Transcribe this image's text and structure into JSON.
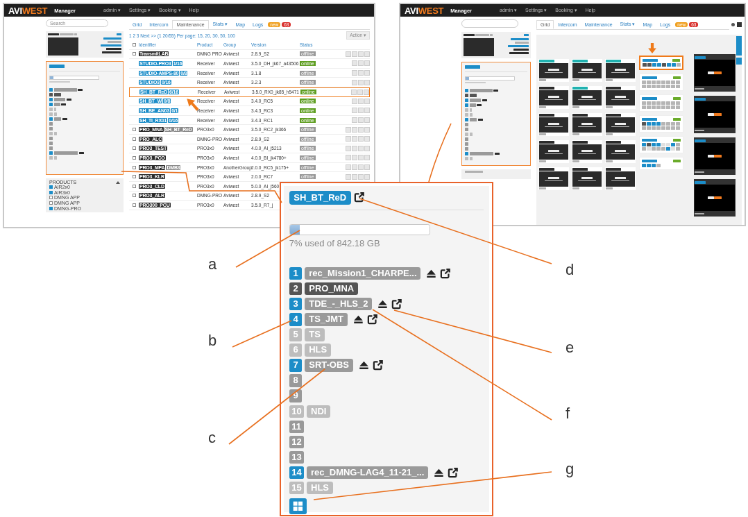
{
  "left_screenshot": {
    "header": {
      "logo": [
        "AVI",
        "WEST"
      ],
      "app_name": "Manager",
      "menu": [
        "admin ▾",
        "Settings ▾",
        "Booking ▾",
        "Help"
      ]
    },
    "search": {
      "placeholder": "Search"
    },
    "products": {
      "title": "PRODUCTS",
      "items": [
        {
          "label": "AIR2x0",
          "checked": true
        },
        {
          "label": "AIR3x0",
          "checked": true
        },
        {
          "label": "DMNG APP",
          "checked": false
        },
        {
          "label": "DMNG APP",
          "checked": false
        },
        {
          "label": "DMNG-PRO",
          "checked": true
        }
      ]
    },
    "tabs": [
      {
        "label": "Grid",
        "selected": false
      },
      {
        "label": "Intercom",
        "selected": false
      },
      {
        "label": "Maintenance",
        "selected": true
      },
      {
        "label": "Stats ▾",
        "selected": false
      },
      {
        "label": "Map",
        "selected": false
      },
      {
        "label": "Logs",
        "selected": false
      }
    ],
    "log_badges": [
      {
        "text": "new",
        "color": "#f0a020"
      },
      {
        "text": "63",
        "color": "#d9302c"
      }
    ],
    "pagination": "1 2 3 Next >> (1 20/55) Per page: 15, 20, 30, 50, 100",
    "action_button": "Action ▾",
    "columns": [
      "Identifier",
      "Product",
      "Group",
      "Version",
      "Status"
    ],
    "select_all": {
      "checked": false
    },
    "rows": [
      {
        "kind": "unit",
        "id": "TransmitLAB",
        "product": "DMNG PRO",
        "group": "Aviwest",
        "version": "2.8.9_S2",
        "status": "offline",
        "online": false,
        "highlighted": false
      },
      {
        "kind": "receiver",
        "id": "STUDIO-PRO3",
        "extra": "1/16",
        "product": "Receiver",
        "group": "Aviwest",
        "version": "3.5.0_DH_jk67_a43506",
        "status": "online",
        "online": true,
        "highlighted": false
      },
      {
        "kind": "receiver",
        "id": "STUDIO-AMPS-80",
        "extra": "0/8",
        "product": "Receiver",
        "group": "Aviwest",
        "version": "3.1.8",
        "status": "offline",
        "online": false,
        "highlighted": false
      },
      {
        "kind": "receiver",
        "id": "STUDIO3",
        "extra": "0/16",
        "product": "Receiver",
        "group": "Aviwest",
        "version": "3.2.3",
        "status": "offline",
        "online": false,
        "highlighted": false
      },
      {
        "kind": "receiver",
        "id": "SH_BT_ReD",
        "extra": "6/16",
        "product": "Receiver",
        "group": "Aviwest",
        "version": "3.5.0_RX0_jk85_h5471",
        "status": "online",
        "online": true,
        "highlighted": true
      },
      {
        "kind": "receiver",
        "id": "SH_BT_W",
        "extra": "0/8",
        "product": "Receiver",
        "group": "Aviwest",
        "version": "3.4.0_RC5",
        "status": "online",
        "online": true,
        "highlighted": false
      },
      {
        "kind": "receiver",
        "id": "SH_BE_AN03",
        "extra": "0/1",
        "product": "Receiver",
        "group": "Aviwest",
        "version": "3.4.3_RC3",
        "status": "online",
        "online": true,
        "highlighted": false
      },
      {
        "kind": "receiver",
        "id": "SH_TI_RX01",
        "extra": "0/16",
        "product": "Receiver",
        "group": "Aviwest",
        "version": "3.4.3_RC1",
        "status": "online",
        "online": true,
        "highlighted": false
      },
      {
        "kind": "unit",
        "id": "PRO_MNA",
        "extra": "SH_BT_ReD",
        "product": "PRO3x0",
        "group": "Aviwest",
        "version": "3.5.0_RC2_jk366",
        "status": "offline",
        "online": false,
        "highlighted": false
      },
      {
        "kind": "unit",
        "id": "PRO_ALC",
        "product": "DMNG-PRO",
        "group": "Aviwest",
        "version": "2.8.9_S2",
        "status": "offline",
        "online": false,
        "highlighted": false
      },
      {
        "kind": "unit",
        "id": "PRO3_TEST",
        "product": "PRO3x0",
        "group": "Aviwest",
        "version": "4.0.0_AI_j5213",
        "status": "offline",
        "online": false,
        "highlighted": false
      },
      {
        "kind": "unit",
        "id": "PRO3_PCO",
        "product": "PRO3x0",
        "group": "Aviwest",
        "version": "4.0.0_BI_jk4780+",
        "status": "offline",
        "online": false,
        "highlighted": false
      },
      {
        "kind": "unit",
        "id": "PRO3_MPA",
        "extra": "DMB3",
        "product": "PRO3x0",
        "group": "AnotherGroup",
        "version": "2.0.0_RC5_jk175+",
        "status": "offline",
        "online": false,
        "highlighted": false
      },
      {
        "kind": "unit",
        "id": "PRO3_KLR",
        "product": "PRO3x0",
        "group": "Aviwest",
        "version": "2.0.0_RC7",
        "status": "offline",
        "online": false,
        "highlighted": false
      },
      {
        "kind": "unit",
        "id": "PRO3_CLD",
        "product": "PRO3x0",
        "group": "Aviwest",
        "version": "5.0.0_AI_j560",
        "highlighted": false
      },
      {
        "kind": "unit",
        "id": "PRO3_ALR",
        "product": "DMNG-PRO",
        "group": "Aviwest",
        "version": "2.8.9_S2",
        "highlighted": false
      },
      {
        "kind": "unit",
        "id": "PRO300_PCU",
        "product": "PRO3x0",
        "group": "Aviwest",
        "version": "3.5.0_R7_j",
        "highlighted": false
      }
    ]
  },
  "right_screenshot": {
    "header": {
      "logo": [
        "AVI",
        "WEST"
      ],
      "app_name": "Manager",
      "menu": [
        "admin ▾",
        "Settings ▾",
        "Booking ▾",
        "Help"
      ]
    },
    "tabs": [
      {
        "label": "Grid",
        "selected": true
      },
      {
        "label": "Intercom",
        "selected": false
      },
      {
        "label": "Maintenance",
        "selected": false
      },
      {
        "label": "Stats ▾",
        "selected": false
      },
      {
        "label": "Map",
        "selected": false
      },
      {
        "label": "Logs",
        "selected": false
      }
    ],
    "log_badges": [
      {
        "text": "new",
        "color": "#f0a020"
      },
      {
        "text": "63",
        "color": "#d9302c"
      }
    ],
    "receivers": [
      {
        "highlighted": true,
        "slots": [
          {
            "kind": "busy"
          },
          {
            "kind": "busy"
          },
          {
            "kind": "active"
          },
          {
            "kind": "active"
          },
          {
            "kind": "busy"
          },
          {
            "kind": "active"
          },
          {
            "kind": "active"
          },
          {
            "kind": "idle"
          }
        ]
      },
      {
        "highlighted": false,
        "slots": [
          {
            "kind": "idle"
          },
          {
            "kind": "idle"
          },
          {
            "kind": "idle"
          },
          {
            "kind": "idle"
          },
          {
            "kind": "idle"
          },
          {
            "kind": "idle"
          },
          {
            "kind": "idle"
          },
          {
            "kind": "idle"
          },
          {
            "kind": "idle"
          },
          {
            "kind": "idle"
          },
          {
            "kind": "idle"
          },
          {
            "kind": "idle"
          },
          {
            "kind": "idle"
          },
          {
            "kind": "idle"
          },
          {
            "kind": "idle"
          },
          {
            "kind": "idle"
          }
        ]
      },
      {
        "highlighted": false,
        "slots": [
          {
            "kind": "idle"
          },
          {
            "kind": "idle"
          },
          {
            "kind": "idle"
          },
          {
            "kind": "idle"
          },
          {
            "kind": "idle"
          },
          {
            "kind": "idle"
          },
          {
            "kind": "idle"
          },
          {
            "kind": "idle"
          },
          {
            "kind": "idle"
          },
          {
            "kind": "idle"
          },
          {
            "kind": "idle"
          },
          {
            "kind": "idle"
          },
          {
            "kind": "idle"
          },
          {
            "kind": "idle"
          },
          {
            "kind": "idle"
          },
          {
            "kind": "idle"
          }
        ]
      },
      {
        "highlighted": false,
        "slots": [
          {
            "kind": "busy"
          },
          {
            "kind": "active"
          },
          {
            "kind": "active"
          },
          {
            "kind": "active"
          },
          {
            "kind": "idle"
          },
          {
            "kind": "idle"
          },
          {
            "kind": "idle"
          },
          {
            "kind": "idle"
          },
          {
            "kind": "idle"
          },
          {
            "kind": "idle"
          },
          {
            "kind": "idle"
          },
          {
            "kind": "idle"
          },
          {
            "kind": "idle"
          },
          {
            "kind": "idle"
          },
          {
            "kind": "idle"
          },
          {
            "kind": "idle"
          }
        ]
      },
      {
        "highlighted": false,
        "slots": [
          {
            "kind": "active"
          },
          {
            "kind": "busy"
          },
          {
            "kind": "active"
          },
          {
            "kind": "active"
          },
          {
            "kind": "disabled"
          },
          {
            "kind": "disabled"
          },
          {
            "kind": "active"
          },
          {
            "kind": "idle"
          },
          {
            "kind": "idle"
          },
          {
            "kind": "disabled"
          },
          {
            "kind": "idle"
          },
          {
            "kind": "idle"
          },
          {
            "kind": "idle"
          },
          {
            "kind": "active"
          },
          {
            "kind": "disabled"
          },
          {
            "kind": "idle"
          }
        ]
      },
      {
        "highlighted": false,
        "slots": [
          {
            "kind": "active"
          },
          {
            "kind": "active"
          },
          {
            "kind": "active"
          },
          {
            "kind": "idle"
          }
        ]
      }
    ]
  },
  "callout": {
    "storage": {
      "title": "SH_BT_ReD",
      "level": 0.07,
      "usage": "7% used of 842.18 GB",
      "channels": [
        {
          "number": "1",
          "kind": "active",
          "name": "rec_Mission1_CHARPE...",
          "actions": true
        },
        {
          "number": "2",
          "kind": "busy",
          "name": "PRO_MNA",
          "actions": false
        },
        {
          "number": "3",
          "kind": "active",
          "name": "TDE_-_HLS_2",
          "actions": true
        },
        {
          "number": "4",
          "kind": "active",
          "name": "TS_JMT",
          "actions": true
        },
        {
          "number": "5",
          "kind": "disabled",
          "name": "TS",
          "actions": false
        },
        {
          "number": "6",
          "kind": "disabled",
          "name": "HLS",
          "actions": false
        },
        {
          "number": "7",
          "kind": "active",
          "name": "SRT-OBS",
          "actions": true
        },
        {
          "number": "8",
          "kind": "idle",
          "actions": false
        },
        {
          "number": "9",
          "kind": "idle",
          "actions": false
        },
        {
          "number": "10",
          "kind": "disabled",
          "name": "NDI",
          "actions": false
        },
        {
          "number": "11",
          "kind": "idle",
          "actions": false
        },
        {
          "number": "12",
          "kind": "idle",
          "actions": false
        },
        {
          "number": "13",
          "kind": "idle",
          "actions": false
        },
        {
          "number": "14",
          "kind": "active",
          "name": "rec_DMNG-LAG4_11-21_...",
          "actions": true
        },
        {
          "number": "15",
          "kind": "disabled",
          "name": "HLS",
          "actions": false
        }
      ]
    }
  },
  "annotations": [
    {
      "letter": "a"
    },
    {
      "letter": "b"
    },
    {
      "letter": "c"
    },
    {
      "letter": "d"
    },
    {
      "letter": "e"
    },
    {
      "letter": "f"
    },
    {
      "letter": "g"
    }
  ]
}
